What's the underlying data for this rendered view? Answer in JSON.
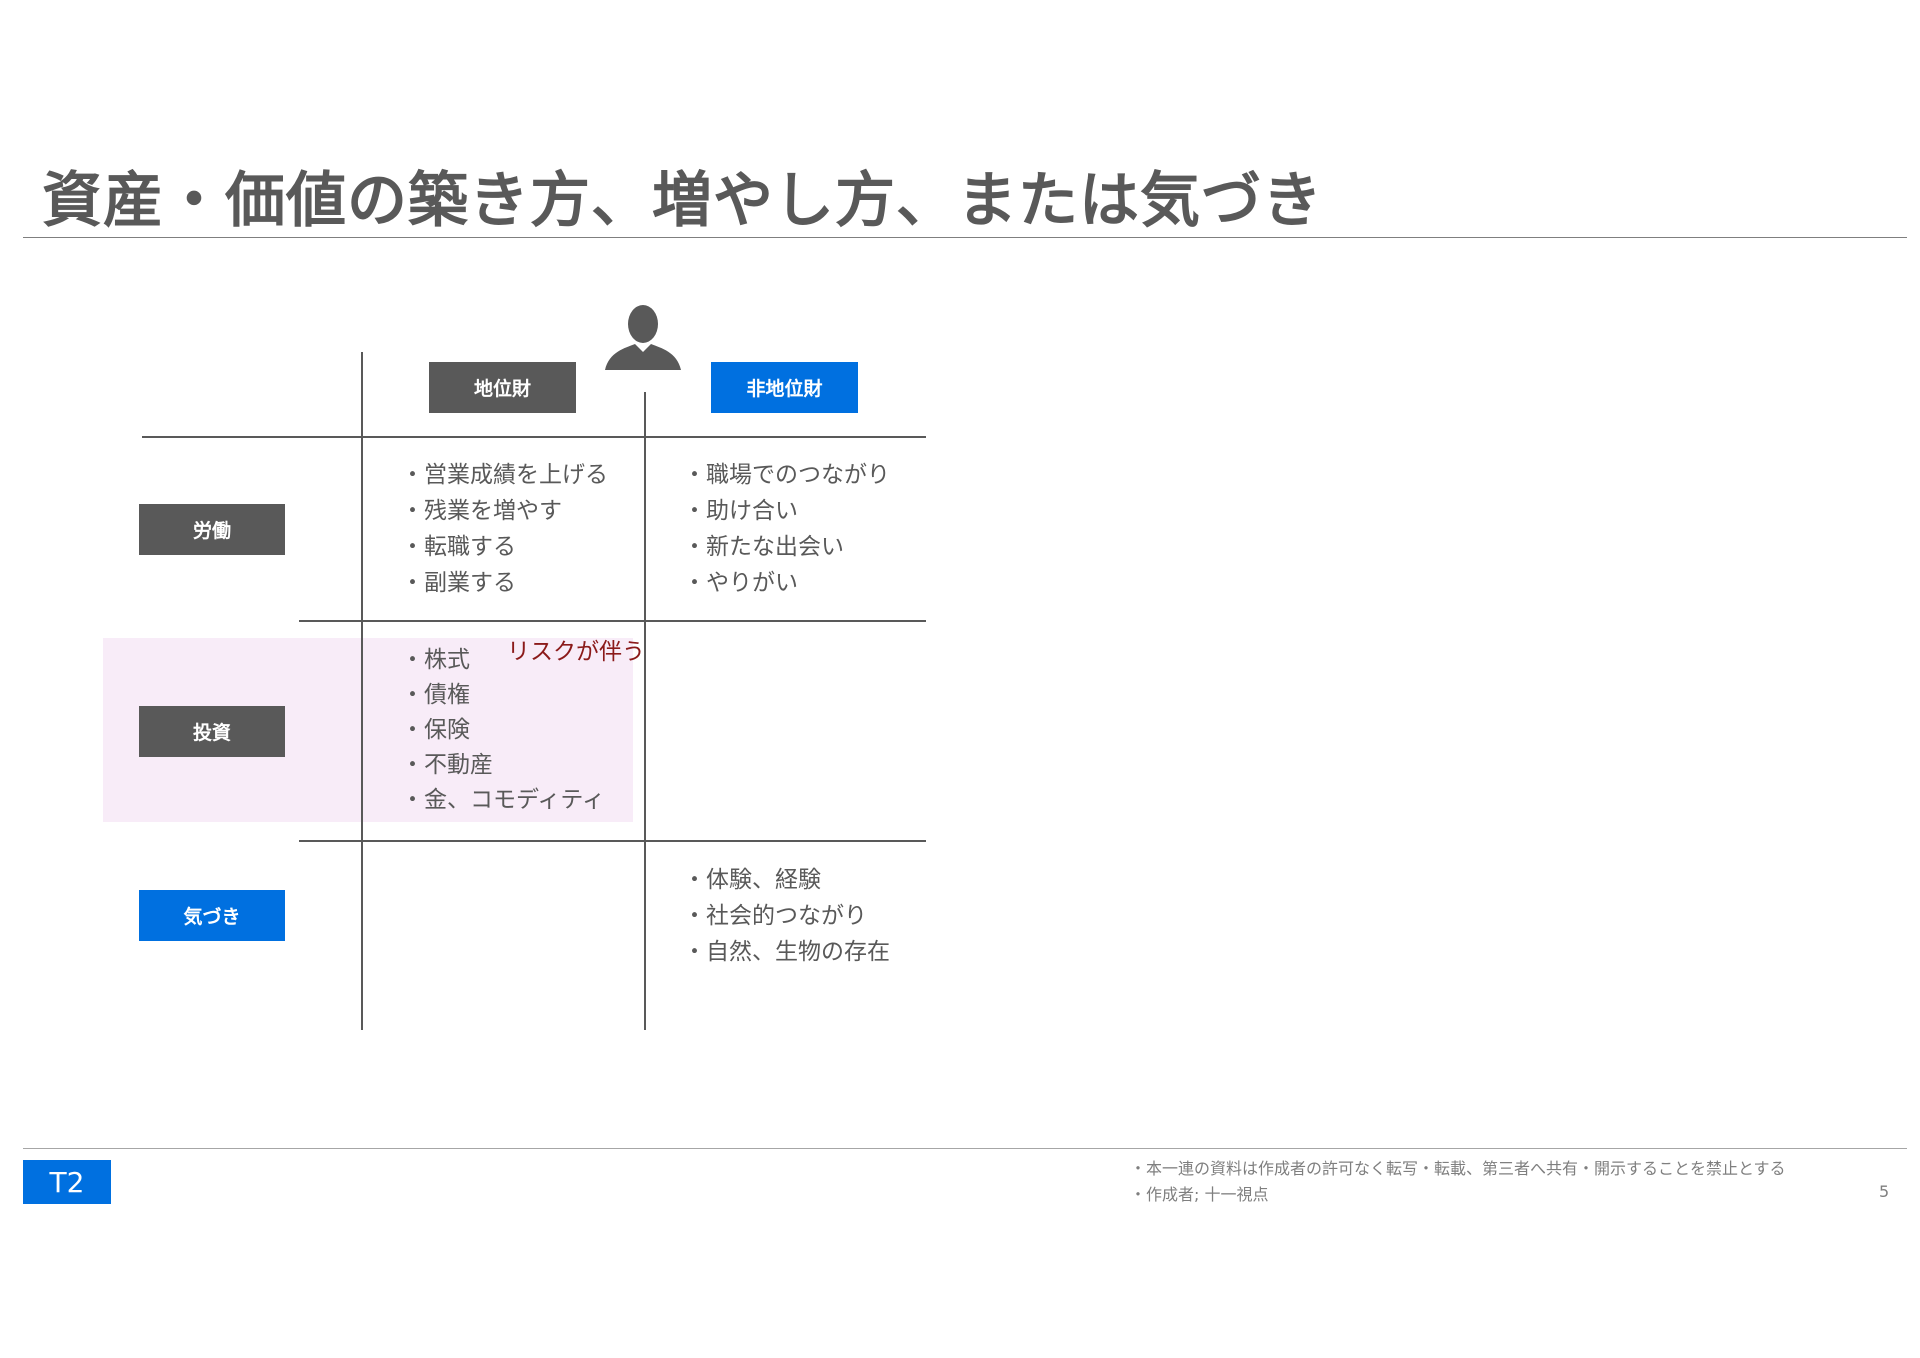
{
  "title": "資産・価値の築き方、増やし方、または気づき",
  "columns": {
    "positional": "地位財",
    "non_positional": "非地位財"
  },
  "rows": {
    "labor": "労働",
    "investment": "投資",
    "awareness": "気づき"
  },
  "cells": {
    "labor_positional": [
      "・営業成績を上げる",
      "・残業を増やす",
      "・転職する",
      "・副業する"
    ],
    "labor_non_positional": [
      "・職場でのつながり",
      "・助け合い",
      "・新たな出会い",
      "・やりがい"
    ],
    "investment_positional": [
      "・株式",
      "・債権",
      "・保険",
      "・不動産",
      "・金、コモディティ"
    ],
    "awareness_non_positional": [
      "・体験、経験",
      "・社会的つながり",
      "・自然、生物の存在"
    ]
  },
  "risk_note": "リスクが伴う",
  "footer": {
    "tag": "T2",
    "notice_lines": [
      "・本一連の資料は作成者の許可なく転写・転載、第三者へ共有・開示することを禁止とする",
      "・作成者; 十一視点"
    ],
    "page_number": "5"
  },
  "icons": {
    "person": "person-silhouette-icon"
  },
  "colors": {
    "accent_blue": "#0070e0",
    "label_gray": "#595959",
    "highlight_pink": "#f8ecf8",
    "risk_red": "#8b1a1a"
  }
}
